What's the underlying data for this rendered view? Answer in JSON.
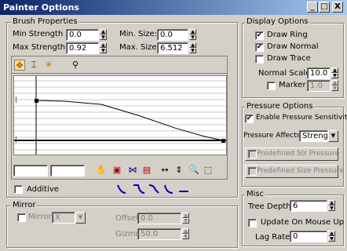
{
  "window": {
    "title": "Painter Options",
    "buttons": [
      "_",
      "□",
      "X"
    ]
  },
  "brush": {
    "legend": "Brush Properties",
    "min_strength_label": "Min Strength",
    "min_strength": "0.0",
    "max_strength_label": "Max Strength",
    "max_strength": "0.92",
    "min_size_label": "Min. Size:",
    "min_size": "0.0",
    "max_size_label": "Max. Size:",
    "max_size": "6.512",
    "additive_label": "Additive"
  },
  "display": {
    "legend": "Display Options",
    "draw_ring": "Draw Ring",
    "draw_normal": "Draw Normal",
    "draw_trace": "Draw Trace",
    "normal_scale_label": "Normal Scale",
    "normal_scale": "10.0",
    "marker_label": "Marker",
    "marker": "1.0"
  },
  "pressure": {
    "legend": "Pressure Options",
    "enable_label": "Enable Pressure Sensitivity",
    "affects_label": "Pressure Affects:",
    "affects_value": "Strength",
    "predefined_str": "Predefined Str Pressure",
    "predefined_size": "Predefined Size Pressure"
  },
  "mirror": {
    "legend": "Mirror",
    "mirror_label": "Mirror",
    "axis": "X",
    "offset_label": "Offset:",
    "offset": "0.0",
    "gizmo_label": "Gizmo Size:",
    "gizmo": "50.0"
  },
  "misc": {
    "legend": "Misc",
    "tree_depth_label": "Tree Depth:",
    "tree_depth": "6",
    "update_label": "Update On Mouse Up",
    "lag_label": "Lag Rate:",
    "lag": "0"
  },
  "curve": {
    "points": [
      [
        0,
        1.0
      ],
      [
        0.15,
        0.98
      ],
      [
        0.35,
        0.9
      ],
      [
        0.55,
        0.62
      ],
      [
        0.75,
        0.3
      ],
      [
        0.9,
        0.1
      ],
      [
        1.0,
        0.0
      ]
    ]
  }
}
